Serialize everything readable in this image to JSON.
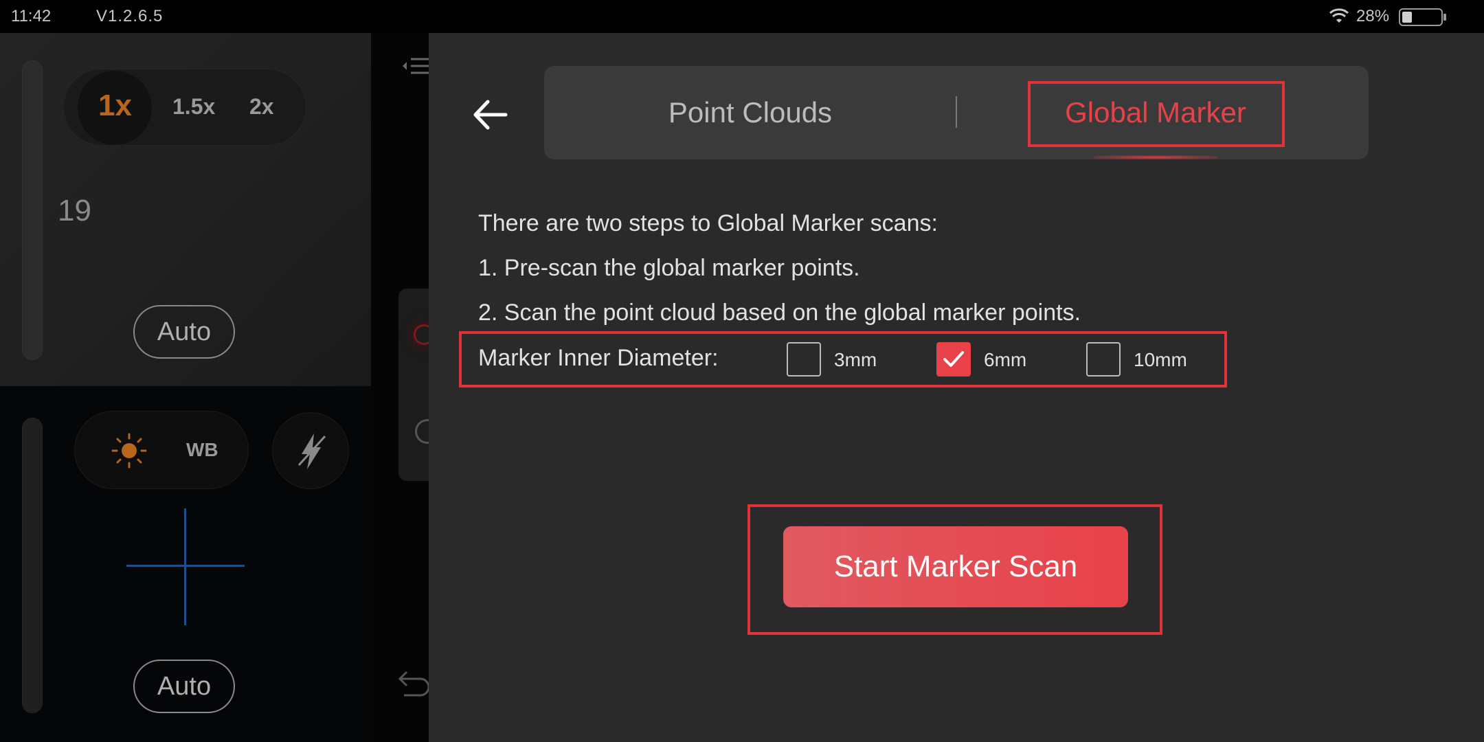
{
  "status_bar": {
    "time": "11:42",
    "version": "V1.2.6.5",
    "battery_percent": "28%",
    "battery_level": 0.28,
    "wifi_icon": "wifi-icon"
  },
  "camera": {
    "zoom_options": [
      "1x",
      "1.5x",
      "2x"
    ],
    "zoom_selected": "1x",
    "exposure_value": "19",
    "auto_label_top": "Auto",
    "auto_label_bottom": "Auto",
    "wb_label": "WB",
    "brightness_icon": "sun-icon",
    "flash_icon": "flash-off-icon"
  },
  "panel": {
    "back_icon": "back-arrow-icon",
    "tabs": [
      {
        "label": "Point Clouds",
        "active": false
      },
      {
        "label": "Global Marker",
        "active": true
      }
    ],
    "description": {
      "intro": "There are two steps to Global Marker scans:",
      "step1": "1. Pre-scan the global marker points.",
      "step2": "2. Scan the point cloud based on the global marker points."
    },
    "diameter": {
      "label": "Marker Inner Diameter:",
      "options": [
        {
          "label": "3mm",
          "checked": false
        },
        {
          "label": "6mm",
          "checked": true
        },
        {
          "label": "10mm",
          "checked": false
        }
      ]
    },
    "start_button_label": "Start Marker Scan"
  },
  "colors": {
    "accent": "#e8414a",
    "highlight_box": "#e03238",
    "panel_bg": "#2a2a2a",
    "tabbar_bg": "#3a3a3a",
    "zoom_accent": "#b8661d"
  }
}
